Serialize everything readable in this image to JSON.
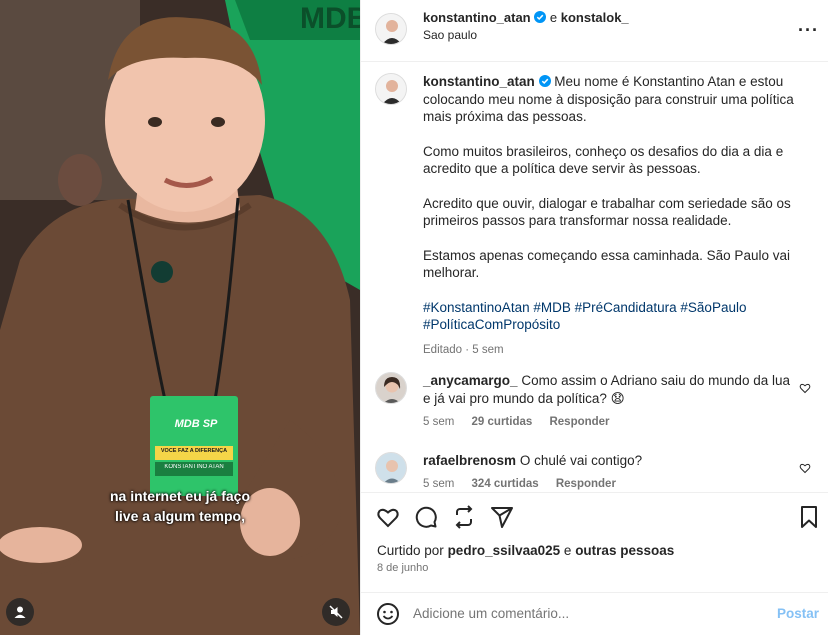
{
  "media": {
    "badge_brand": "MDB SP",
    "badge_text": "VOCÊ FAZ A DIFERENÇA",
    "badge_name": "KONSTANTINO ATAN",
    "subtitle_line1": "na internet eu já faço",
    "subtitle_line2": "live a algum tempo,"
  },
  "header": {
    "username": "konstantino_atan",
    "connector": "e",
    "collaborator": "konstalok_",
    "location": "Sao paulo"
  },
  "caption": {
    "username": "konstantino_atan",
    "p1": "Meu nome é Konstantino Atan e estou colocando meu nome à disposição para construir uma política mais próxima das pessoas.",
    "p2": "Como muitos brasileiros, conheço os desafios do dia a dia e acredito que a política deve servir às pessoas.",
    "p3": "Acredito que ouvir, dialogar e trabalhar com seriedade são os primeiros passos para transformar nossa realidade.",
    "p4": "Estamos apenas começando essa caminhada. São Paulo vai melhorar.",
    "hashtags": "#KonstantinoAtan #MDB #PréCandidatura #SãoPaulo #PolíticaComPropósito",
    "edited": "Editado · 5 sem"
  },
  "comments": [
    {
      "username": "_anycamargo_",
      "text": "Como assim o Adriano saiu do mundo da lua e já vai pro mundo da política? 😧",
      "time": "5 sem",
      "likes": "29 curtidas",
      "reply": "Responder"
    },
    {
      "username": "rafaelbrenosm",
      "text": "O chulé vai contigo?",
      "time": "5 sem",
      "likes": "324 curtidas",
      "reply": "Responder"
    }
  ],
  "likes": {
    "prefix": "Curtido por",
    "user": "pedro_ssilvaa025",
    "connector": "e",
    "others": "outras pessoas"
  },
  "date": "8 de junho",
  "add_comment": {
    "placeholder": "Adicione um comentário...",
    "post_label": "Postar"
  },
  "colors": {
    "verified": "#0095f6",
    "link": "#00376b",
    "post_disabled": "#85c1f5",
    "muted": "#737373",
    "banner_green": "#1aa35a"
  },
  "icons": [
    "more-options-icon",
    "heart-icon",
    "comment-icon",
    "share-icon",
    "send-icon",
    "save-icon",
    "emoji-icon",
    "user-tag-icon",
    "mute-icon",
    "verified-icon"
  ]
}
